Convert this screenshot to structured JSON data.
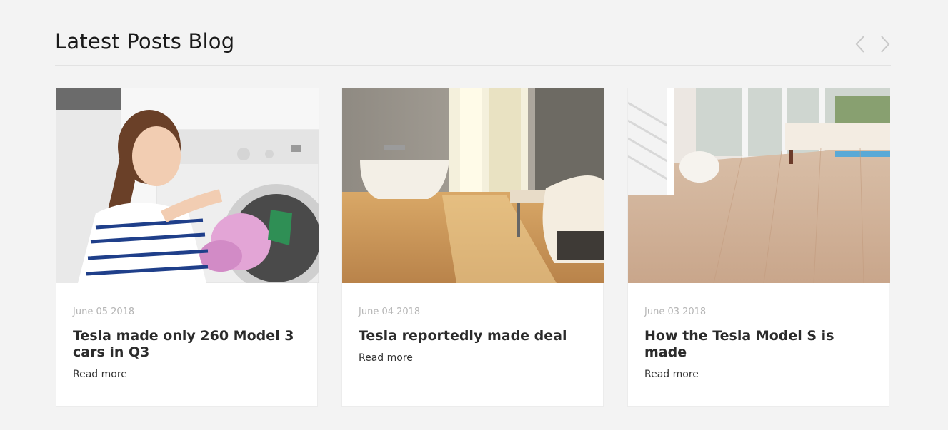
{
  "section": {
    "title": "Latest Posts Blog"
  },
  "navigation": {
    "prev_icon": "chevron-left-icon",
    "next_icon": "chevron-right-icon",
    "icon_color": "#c8c8c8"
  },
  "posts": [
    {
      "date": "June 05 2018",
      "title": "Tesla made only 260 Model 3 cars in Q3",
      "read_more": "Read more",
      "image_subject": "woman loading a washing machine"
    },
    {
      "date": "June 04 2018",
      "title": "Tesla reportedly made deal",
      "read_more": "Read more",
      "image_subject": "bathroom with freestanding tub and wood floor"
    },
    {
      "date": "June 03 2018",
      "title": "How the Tesla Model S is made",
      "read_more": "Read more",
      "image_subject": "bright living room with light wood floor"
    }
  ],
  "colors": {
    "background": "#f3f3f3",
    "card": "#ffffff",
    "title": "#1a1a1a",
    "date": "#b5b5b5"
  }
}
